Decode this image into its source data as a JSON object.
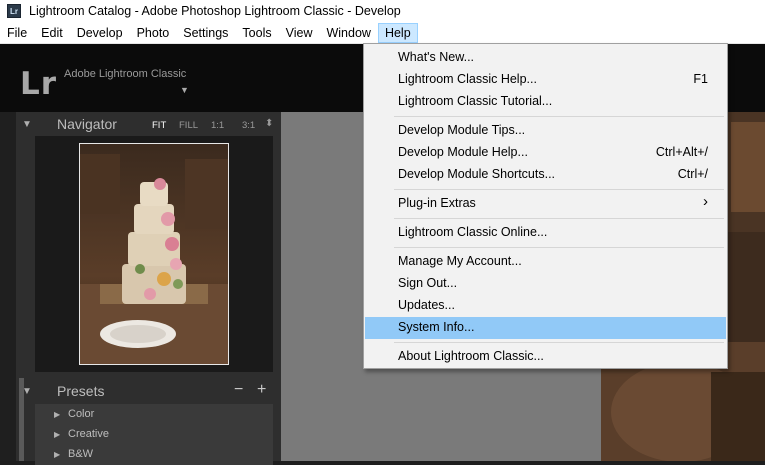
{
  "window": {
    "title": "Lightroom Catalog - Adobe Photoshop Lightroom Classic - Develop",
    "icon_text": "Lr"
  },
  "menubar": [
    "File",
    "Edit",
    "Develop",
    "Photo",
    "Settings",
    "Tools",
    "View",
    "Window",
    "Help"
  ],
  "identity": {
    "logo": "Lr",
    "name": "Adobe Lightroom Classic"
  },
  "navigator": {
    "title": "Navigator",
    "options": [
      "FIT",
      "FILL",
      "1:1",
      "3:1"
    ],
    "selected": "FIT"
  },
  "presets": {
    "title": "Presets",
    "minus": "−",
    "plus": "+",
    "items": [
      "Color",
      "Creative",
      "B&W"
    ]
  },
  "help_menu": {
    "items": [
      {
        "label": "What's New...",
        "shortcut": ""
      },
      {
        "label": "Lightroom Classic Help...",
        "shortcut": "F1"
      },
      {
        "label": "Lightroom Classic Tutorial...",
        "shortcut": ""
      },
      {
        "label": "Develop Module Tips...",
        "shortcut": ""
      },
      {
        "label": "Develop Module Help...",
        "shortcut": "Ctrl+Alt+/"
      },
      {
        "label": "Develop Module Shortcuts...",
        "shortcut": "Ctrl+/"
      },
      {
        "label": "Plug-in Extras",
        "shortcut": "›"
      },
      {
        "label": "Lightroom Classic Online...",
        "shortcut": ""
      },
      {
        "label": "Manage My Account...",
        "shortcut": ""
      },
      {
        "label": "Sign Out...",
        "shortcut": ""
      },
      {
        "label": "Updates...",
        "shortcut": ""
      },
      {
        "label": "System Info...",
        "shortcut": ""
      },
      {
        "label": "About Lightroom Classic...",
        "shortcut": ""
      }
    ],
    "highlighted": "System Info..."
  },
  "colors": {
    "highlight": "#91c9f7",
    "menu_active": "#cce8ff"
  }
}
